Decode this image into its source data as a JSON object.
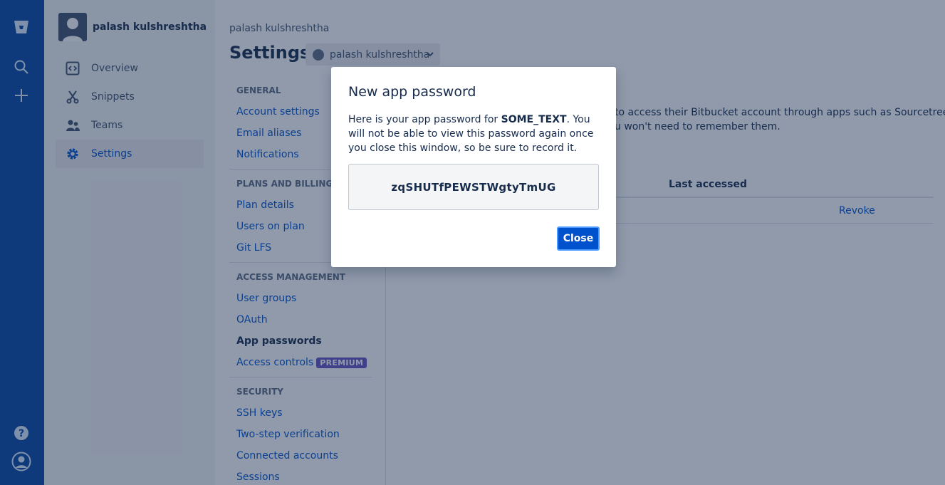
{
  "user": {
    "name": "palash kulshreshtha"
  },
  "sidebar": {
    "items": [
      {
        "label": "Overview",
        "icon": "code-icon"
      },
      {
        "label": "Snippets",
        "icon": "scissors-icon"
      },
      {
        "label": "Teams",
        "icon": "people-icon"
      },
      {
        "label": "Settings",
        "icon": "gear-icon",
        "active": true
      }
    ]
  },
  "header": {
    "breadcrumb": "palash kulshreshtha",
    "title": "Settings",
    "account_select": "palash kulshreshtha"
  },
  "settings_nav": {
    "general": {
      "title": "GENERAL",
      "links": [
        "Account settings",
        "Email aliases",
        "Notifications"
      ]
    },
    "plans": {
      "title": "PLANS AND BILLING",
      "links": [
        "Plan details",
        "Users on plan",
        "Git LFS"
      ]
    },
    "access": {
      "title": "ACCESS MANAGEMENT",
      "links": [
        "User groups",
        "OAuth",
        "App passwords",
        "Access controls"
      ],
      "premium_badge": "PREMIUM"
    },
    "security": {
      "title": "SECURITY",
      "links": [
        "SSH keys",
        "Two-step verification",
        "Connected accounts",
        "Sessions"
      ]
    }
  },
  "content": {
    "line1": "to access their Bitbucket account through apps such as Sourcetree.",
    "line2": "u won't need to remember them.",
    "table": {
      "last_accessed_header": "Last accessed",
      "row_action": "Revoke"
    }
  },
  "modal": {
    "title": "New app password",
    "body_prefix": "Here is your app password for ",
    "body_bold": "SOME_TEXT",
    "body_suffix": ". You will not be able to view this password again once you close this window, so be sure to record it.",
    "password": "zqSHUTfPEWSTWgtyTmUG",
    "close_label": "Close"
  },
  "colors": {
    "global_nav": "#0747a6",
    "link": "#0052cc",
    "premium": "#6554c0"
  }
}
